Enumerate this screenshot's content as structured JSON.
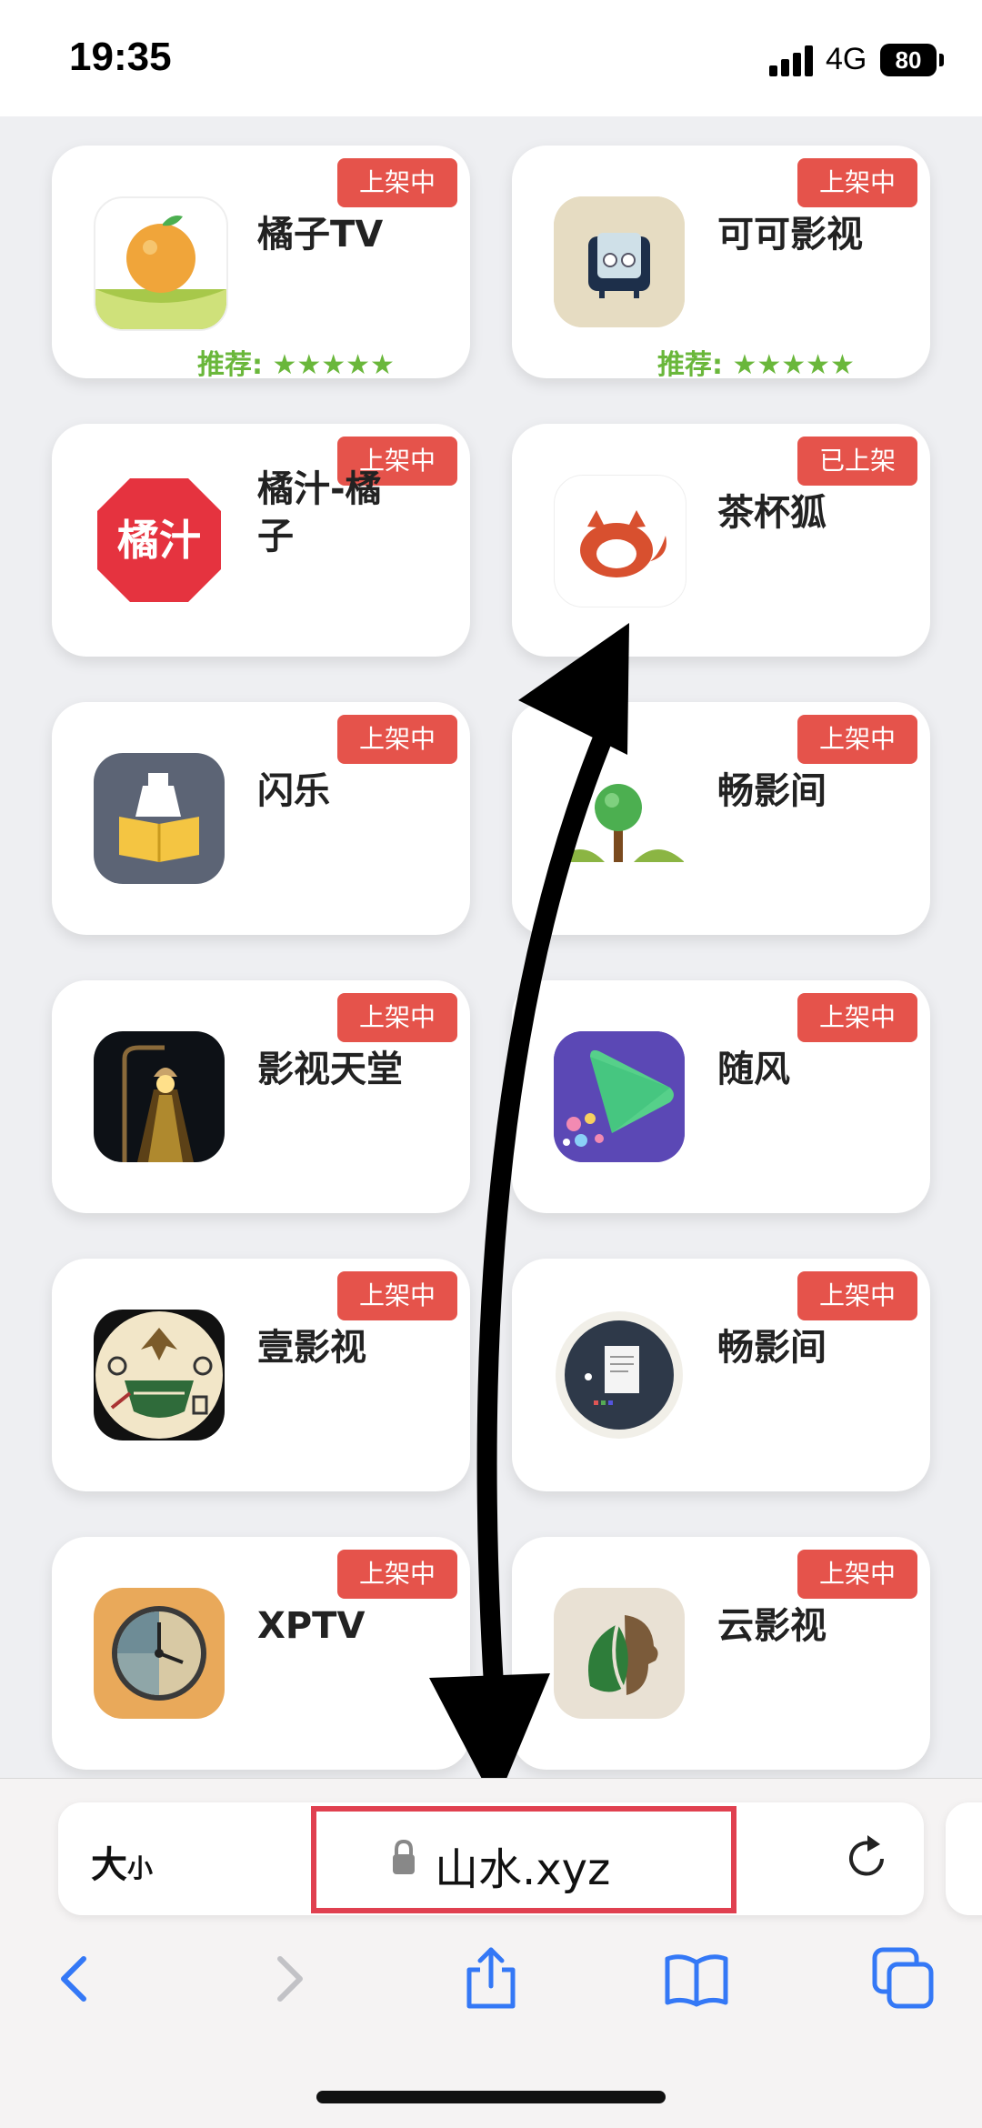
{
  "status_bar": {
    "time": "19:35",
    "network": "4G",
    "battery": "80"
  },
  "apps": [
    {
      "name": "橘子TV",
      "badge": "上架中",
      "rating": "推荐: ★★★★★",
      "icon": "orange-fruit-icon"
    },
    {
      "name": "可可影视",
      "badge": "上架中",
      "rating": "推荐: ★★★★★",
      "icon": "retro-tv-icon"
    },
    {
      "name": "橘汁-橘子",
      "badge": "上架中",
      "rating": "",
      "icon": "juice-text-icon",
      "icon_text": "橘汁"
    },
    {
      "name": "茶杯狐",
      "badge": "已上架",
      "rating": "",
      "icon": "fox-icon"
    },
    {
      "name": "闪乐",
      "badge": "上架中",
      "rating": "",
      "icon": "book-bottle-icon"
    },
    {
      "name": "畅影间",
      "badge": "上架中",
      "rating": "",
      "icon": "tree-icon"
    },
    {
      "name": "影视天堂",
      "badge": "上架中",
      "rating": "",
      "icon": "lamp-icon"
    },
    {
      "name": "随风",
      "badge": "上架中",
      "rating": "",
      "icon": "play-arrow-icon"
    },
    {
      "name": "壹影视",
      "badge": "上架中",
      "rating": "",
      "icon": "emblem-icon"
    },
    {
      "name": "畅影间",
      "badge": "上架中",
      "rating": "",
      "icon": "document-circle-icon"
    },
    {
      "name": "XPTV",
      "badge": "上架中",
      "rating": "",
      "icon": "clock-icon"
    },
    {
      "name": "云影视",
      "badge": "上架中",
      "rating": "",
      "icon": "leaf-lion-icon"
    }
  ],
  "browser": {
    "text_size_label": "大",
    "text_size_small": "小",
    "url": "山水.xyz"
  },
  "colors": {
    "badge": "#e5534b",
    "rating": "#6ab73b",
    "highlight": "#e04050",
    "accent": "#3478f6"
  }
}
